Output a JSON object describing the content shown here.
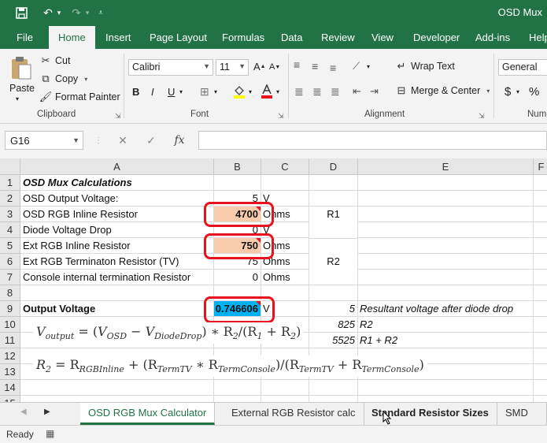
{
  "window": {
    "title": "OSD Mux"
  },
  "ribbon_tabs": [
    "File",
    "Home",
    "Insert",
    "Page Layout",
    "Formulas",
    "Data",
    "Review",
    "View",
    "Developer",
    "Add-ins",
    "Help"
  ],
  "clipboard": {
    "paste": "Paste",
    "cut": "Cut",
    "copy": "Copy",
    "format_painter": "Format Painter",
    "label": "Clipboard"
  },
  "font": {
    "name": "Calibri",
    "size": "11",
    "bold": "B",
    "italic": "I",
    "underline": "U",
    "label": "Font"
  },
  "alignment": {
    "wrap": "Wrap Text",
    "merge": "Merge & Center",
    "label": "Alignment"
  },
  "number": {
    "format": "General",
    "currency": "$",
    "percent": "%",
    "label": "Num"
  },
  "formula_bar": {
    "name_box": "G16",
    "fx": "fx"
  },
  "columns": [
    "A",
    "B",
    "C",
    "D",
    "E",
    "F"
  ],
  "rows": [
    "1",
    "2",
    "3",
    "4",
    "5",
    "6",
    "7",
    "8",
    "9",
    "10",
    "11",
    "12",
    "13",
    "14",
    "15"
  ],
  "cells": {
    "A1": "OSD Mux Calculations",
    "A2": "OSD Output Voltage:",
    "B2": "5",
    "C2": "V",
    "A3": "OSD RGB Inline Resistor",
    "B3": "4700",
    "C3": "Ohms",
    "D3": "R1",
    "A4": "Diode Voltage Drop",
    "B4": "0",
    "C4": "V",
    "A5": "Ext RGB Inline Resistor",
    "B5": "750",
    "C5": "Ohms",
    "A6": "Ext RGB Terminaton Resistor (TV)",
    "B6": "75",
    "C6": "Ohms",
    "D6": "R2",
    "A7": "Console internal termination Resistor",
    "B7": "0",
    "C7": "Ohms",
    "A9": "Output Voltage",
    "B9": "0.746606",
    "C9": "V",
    "D9": "5",
    "E9": "Resultant voltage after diode drop",
    "D10": "825",
    "E10": "R2",
    "D11": "5525",
    "E11": "R1 + R2"
  },
  "equations": {
    "eq1": {
      "lhs": "V",
      "lhs_sub": "output",
      "eq": " = (",
      "v": "V",
      "v_sub": "OSD",
      "minus": " − ",
      "vd": "V",
      "vd_sub": "DiodeDrop",
      "rest": ") ∗ R",
      "r2": "2",
      "div": "/(R",
      "r1": "1",
      "plus": " + R",
      "r2b": "2",
      "close": ")"
    },
    "eq2": {
      "lhs": "R",
      "lhs_sub": "2",
      "eq": " = R",
      "a_sub": "RGBInline",
      "p1": " + (R",
      "b_sub": "TermTV",
      "m": " ∗ R",
      "c_sub": "TermConsole",
      "d": ")/(R",
      "d_sub": "TermTV",
      "p2": " + R",
      "e_sub": "TermConsole",
      "close": ")"
    }
  },
  "sheets": [
    "OSD RGB Mux Calculator",
    "External RGB Resistor calc",
    "Standard Resistor Sizes",
    "SMD Res"
  ],
  "status": {
    "ready": "Ready"
  },
  "colors": {
    "excel_green": "#217346",
    "input_orange": "#f8cbad",
    "output_blue": "#00b0f0",
    "highlight_red": "#e8121f"
  }
}
